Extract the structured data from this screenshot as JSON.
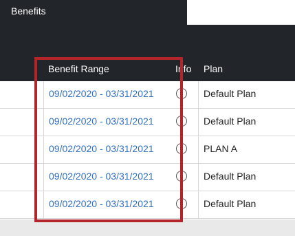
{
  "header": {
    "title": "Benefits"
  },
  "table": {
    "columns": {
      "range": "Benefit Range",
      "info": "Info",
      "plan": "Plan"
    },
    "rows": [
      {
        "range": "09/02/2020 - 03/31/2021",
        "plan": "Default Plan"
      },
      {
        "range": "09/02/2020 - 03/31/2021",
        "plan": "Default Plan"
      },
      {
        "range": "09/02/2020 - 03/31/2021",
        "plan": "PLAN A"
      },
      {
        "range": "09/02/2020 - 03/31/2021",
        "plan": "Default Plan"
      },
      {
        "range": "09/02/2020 - 03/31/2021",
        "plan": "Default Plan"
      }
    ]
  },
  "colors": {
    "dark_header": "#22262b",
    "link": "#2f6fc4",
    "highlight_border": "#b3252b"
  }
}
